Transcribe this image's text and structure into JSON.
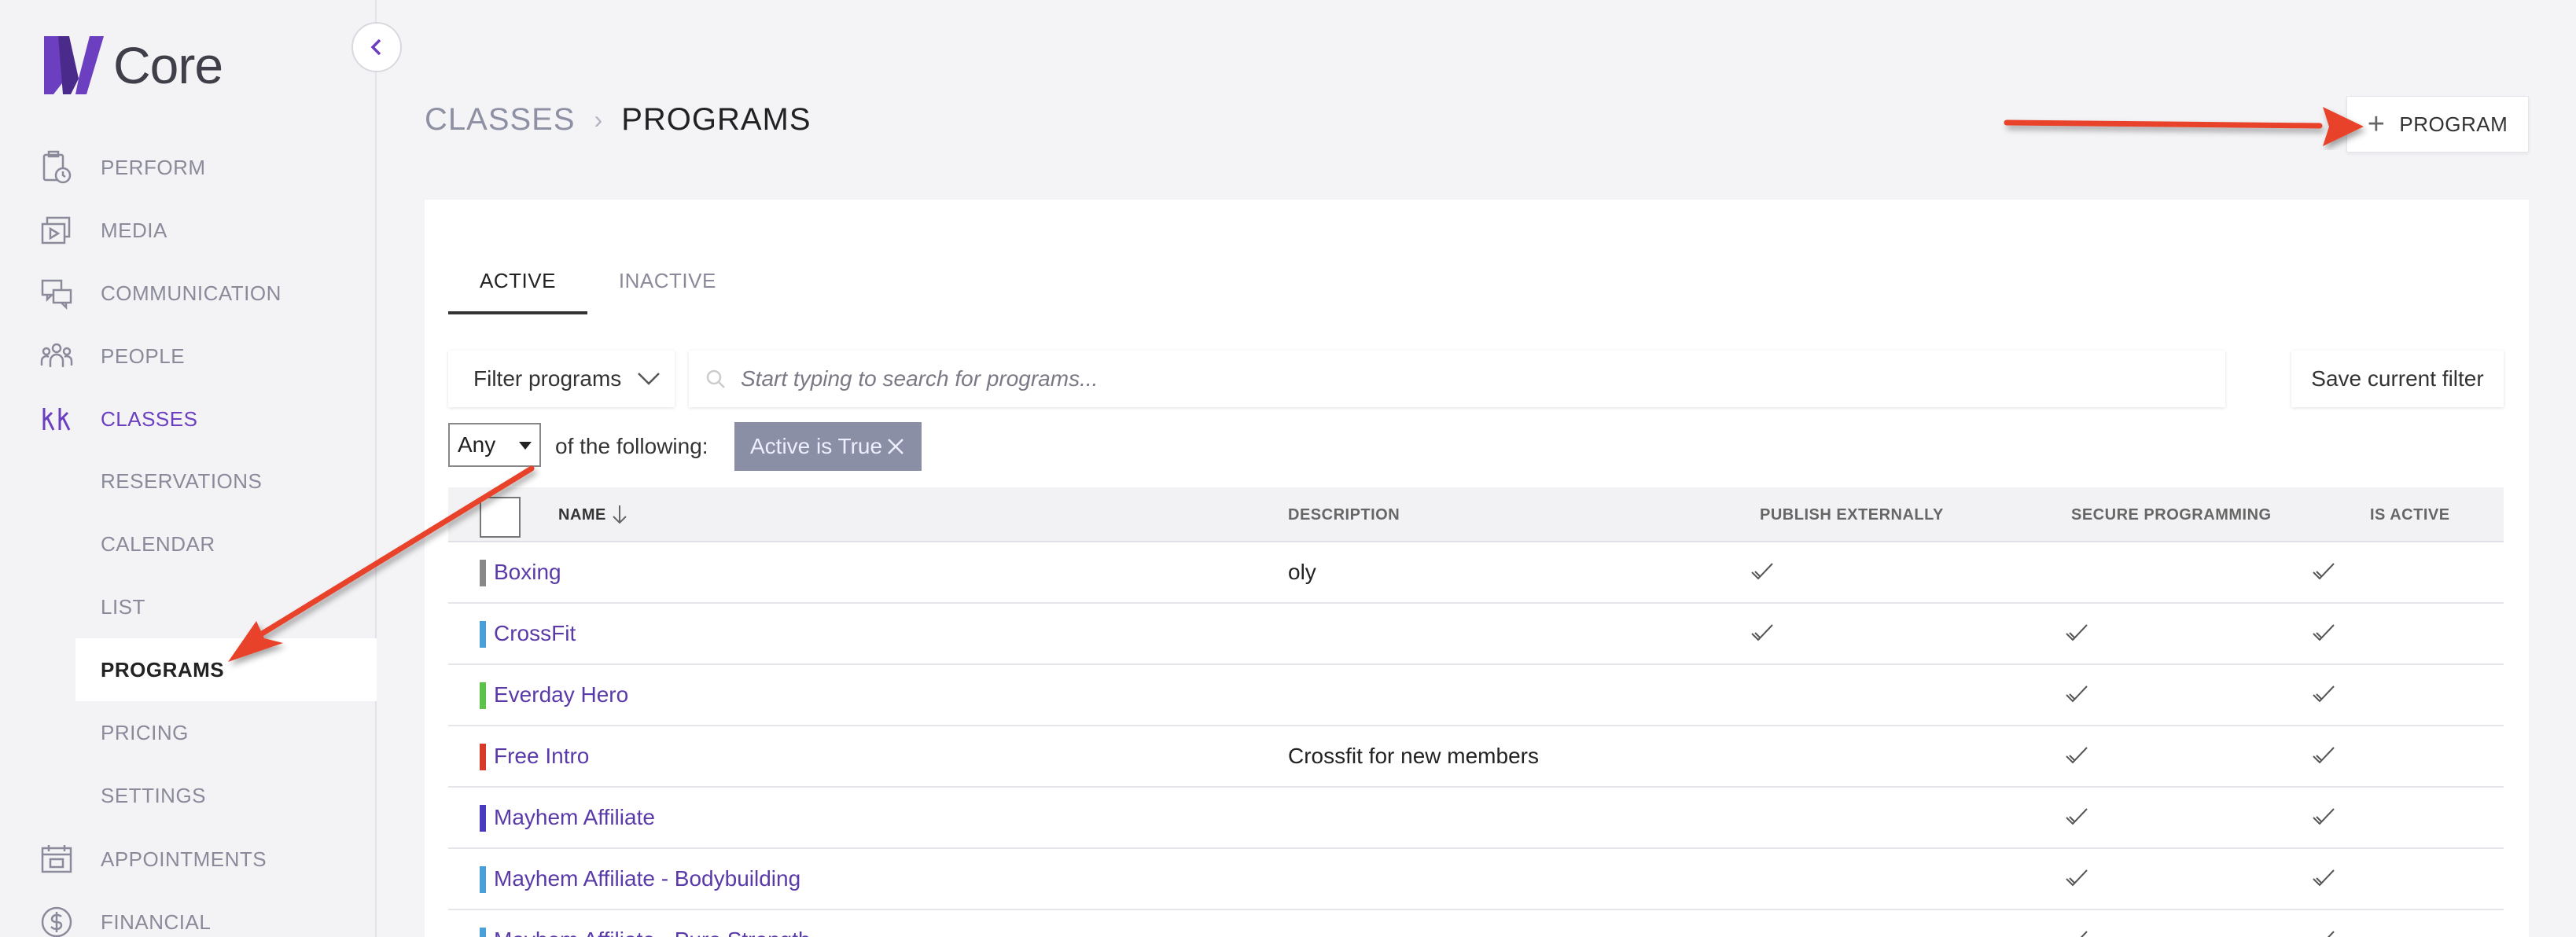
{
  "app": {
    "logo_text": "Core"
  },
  "sidebar": {
    "items": [
      {
        "label": "PERFORM",
        "icon": "clipboard-clock-icon"
      },
      {
        "label": "MEDIA",
        "icon": "media-play-icon"
      },
      {
        "label": "COMMUNICATION",
        "icon": "chat-bubbles-icon"
      },
      {
        "label": "PEOPLE",
        "icon": "people-group-icon"
      },
      {
        "label": "CLASSES",
        "icon": "classes-icon"
      },
      {
        "label": "APPOINTMENTS",
        "icon": "calendar-icon"
      },
      {
        "label": "FINANCIAL",
        "icon": "dollar-icon"
      }
    ],
    "sub_items": [
      {
        "label": "RESERVATIONS"
      },
      {
        "label": "CALENDAR"
      },
      {
        "label": "LIST"
      },
      {
        "label": "PROGRAMS"
      },
      {
        "label": "PRICING"
      },
      {
        "label": "SETTINGS"
      }
    ]
  },
  "header": {
    "breadcrumb_parent": "CLASSES",
    "breadcrumb_sep": "›",
    "breadcrumb_current": "PROGRAMS",
    "add_button_label": "PROGRAM"
  },
  "tabs": [
    {
      "label": "ACTIVE"
    },
    {
      "label": "INACTIVE"
    }
  ],
  "filters": {
    "filter_button_label": "Filter programs",
    "search_placeholder": "Start typing to search for programs...",
    "save_button_label": "Save current filter",
    "match_mode": "Any",
    "of_following": "of the following:",
    "chip_label": "Active is True"
  },
  "table": {
    "columns": {
      "name": "NAME",
      "description": "DESCRIPTION",
      "publish": "PUBLISH EXTERNALLY",
      "secure": "SECURE PROGRAMMING",
      "active": "IS ACTIVE"
    },
    "rows": [
      {
        "name": "Boxing",
        "description": "oly",
        "color": "#888888",
        "publish": true,
        "secure": false,
        "active": true
      },
      {
        "name": "CrossFit",
        "description": "",
        "color": "#4a9fd8",
        "publish": true,
        "secure": true,
        "active": true
      },
      {
        "name": "Everday Hero",
        "description": "",
        "color": "#5cc24a",
        "publish": false,
        "secure": true,
        "active": true
      },
      {
        "name": "Free Intro",
        "description": "Crossfit for new members",
        "color": "#d83a2a",
        "publish": false,
        "secure": true,
        "active": true
      },
      {
        "name": "Mayhem Affiliate",
        "description": "",
        "color": "#4a3ac0",
        "publish": false,
        "secure": true,
        "active": true
      },
      {
        "name": "Mayhem Affiliate - Bodybuilding",
        "description": "",
        "color": "#4a9fd8",
        "publish": false,
        "secure": true,
        "active": true
      },
      {
        "name": "Mayhem Affiliate - Pure Strength",
        "description": "",
        "color": "#4a9fd8",
        "publish": false,
        "secure": true,
        "active": true
      }
    ]
  },
  "colors": {
    "accent": "#6b3fc0",
    "annotation_arrow": "#e8432a"
  }
}
